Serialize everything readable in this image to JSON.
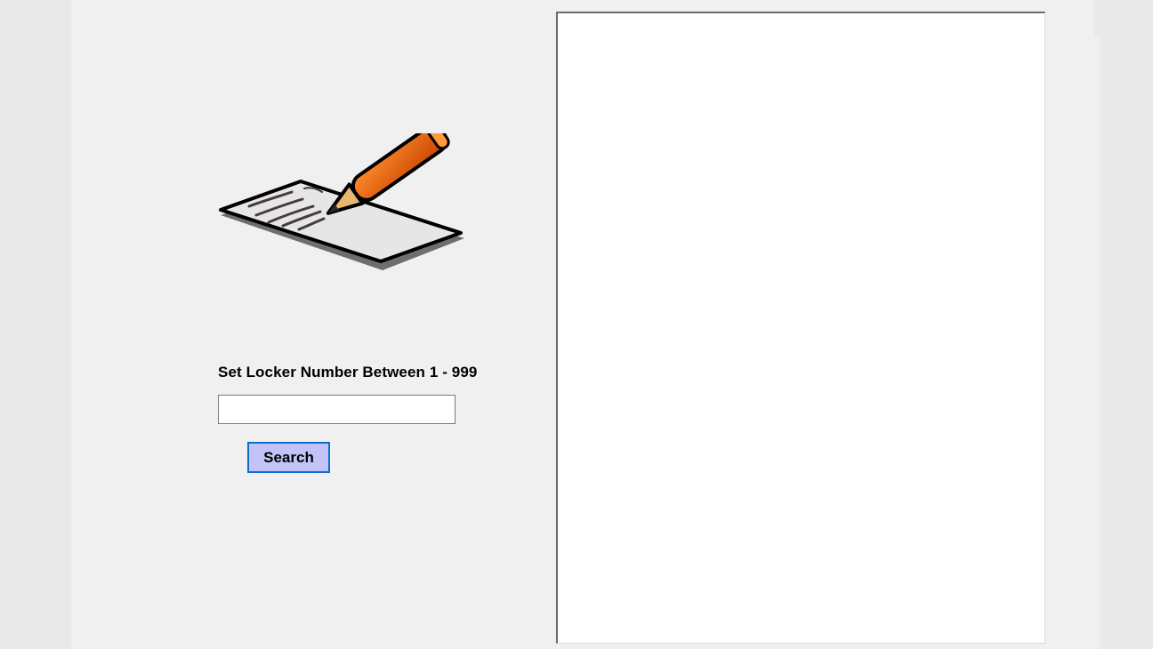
{
  "form": {
    "logo_icon": "note-with-pencil-icon",
    "prompt_label": "Set Locker Number Between 1 - 999",
    "locker_number_value": "",
    "search_button_label": "Search",
    "results_text": ""
  },
  "colors": {
    "window_background": "#f0f0f0",
    "button_background": "#c3c3f7",
    "button_border": "#0a6ed1",
    "pencil_body": "#e35a05"
  }
}
